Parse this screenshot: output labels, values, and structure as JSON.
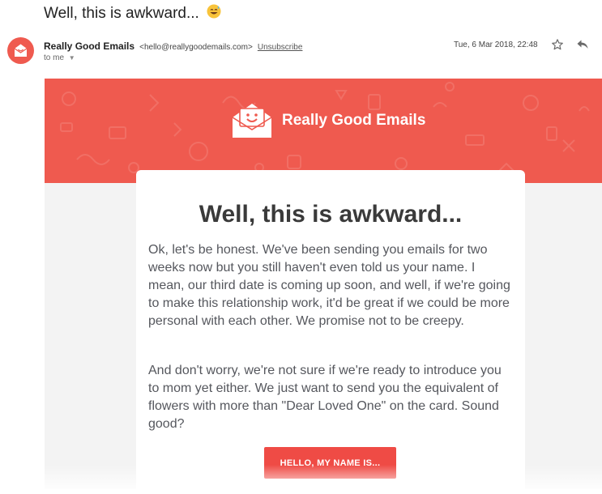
{
  "email": {
    "subject": "Well, this is awkward...",
    "subject_emoji": "grinning-face-with-sweat-icon",
    "sender_name": "Really Good Emails",
    "sender_email": "<hello@reallygoodemails.com>",
    "unsubscribe_label": "Unsubscribe",
    "recipient": "to me",
    "date": "Tue, 6 Mar 2018, 22:48"
  },
  "body": {
    "brand_name": "Really Good Emails",
    "title": "Well, this is awkward...",
    "paragraph1": "Ok, let's be honest. We've been sending you emails for two weeks now but you still haven't even told us your name. I mean, our third date is coming up soon, and well, if we're going to make this relationship work, it'd be great if we could be more personal with each other. We promise not to be creepy.",
    "paragraph2": "And don't worry, we're not sure if we're ready to introduce you to mom yet either. We just want to send you the equivalent of flowers with more than \"Dear Loved One\" on the card. Sound good?",
    "cta_label": "HELLO, MY NAME IS..."
  },
  "colors": {
    "brand_red": "#ef5a4f",
    "button_red": "#ef4b45",
    "title_gray": "#3a3a3a",
    "body_gray": "#55575d"
  }
}
